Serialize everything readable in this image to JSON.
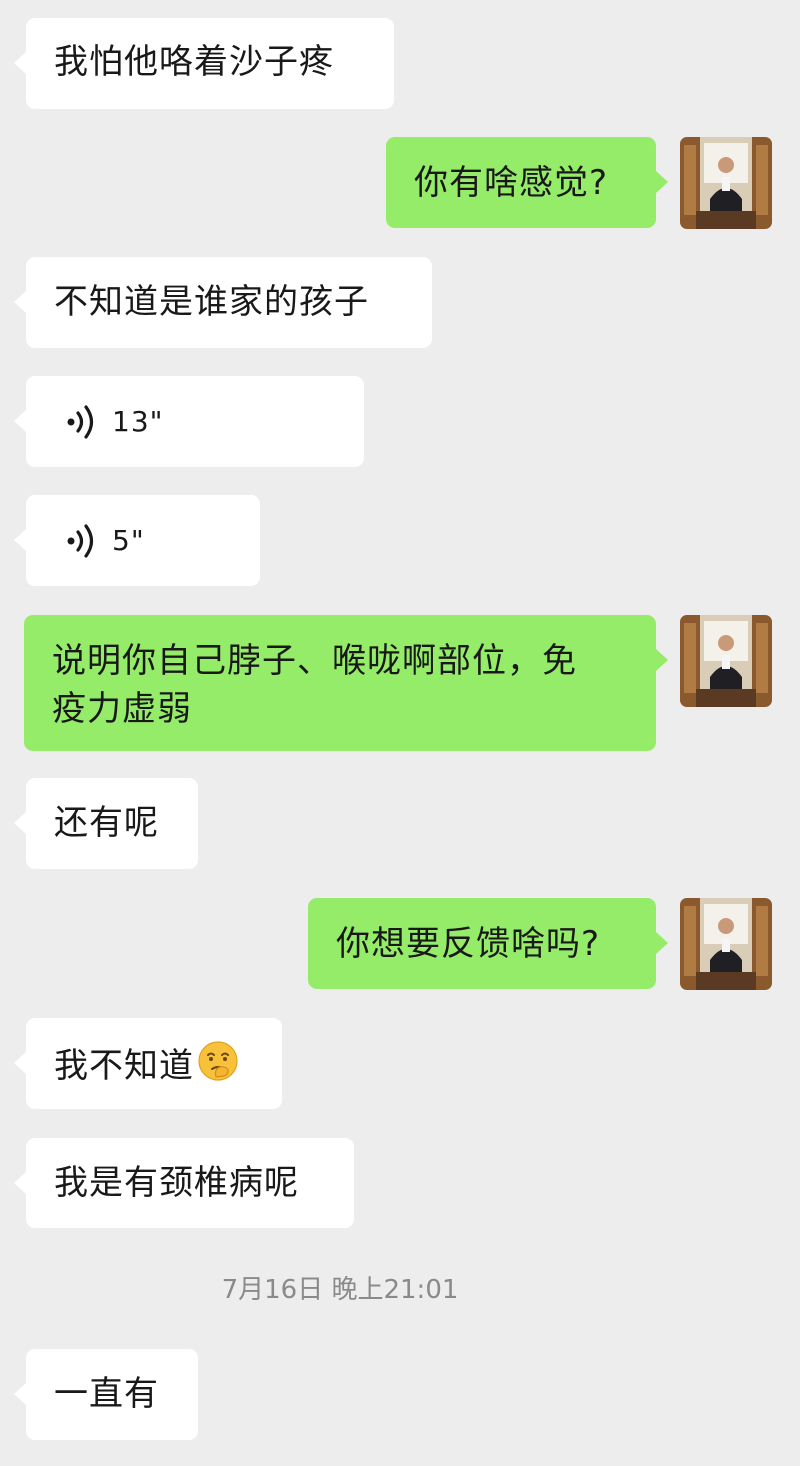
{
  "chat": {
    "messages": [
      {
        "side": "in",
        "type": "text",
        "text": "我怕他咯着沙子疼"
      },
      {
        "side": "out",
        "type": "text",
        "text": "你有啥感觉?"
      },
      {
        "side": "in",
        "type": "text",
        "text": "不知道是谁家的孩子"
      },
      {
        "side": "in",
        "type": "voice",
        "duration": "13\""
      },
      {
        "side": "in",
        "type": "voice",
        "duration": "5\""
      },
      {
        "side": "out",
        "type": "text",
        "line1": "说明你自己脖子、喉咙啊部位，免",
        "line2": "疫力虚弱"
      },
      {
        "side": "in",
        "type": "text",
        "text": "还有呢"
      },
      {
        "side": "out",
        "type": "text",
        "text": "你想要反馈啥吗?"
      },
      {
        "side": "in",
        "type": "text",
        "text": "我不知道",
        "emoji": "thinking-face-emoji"
      },
      {
        "side": "in",
        "type": "text",
        "text": "我是有颈椎病呢"
      },
      {
        "side": "in",
        "type": "text",
        "text": "一直有"
      }
    ],
    "timestamp": "7月16日 晚上21:01"
  },
  "colors": {
    "background": "#ededed",
    "incoming_bubble": "#ffffff",
    "outgoing_bubble": "#95ec69",
    "timestamp_text": "#8a8a8a"
  },
  "icons": {
    "voice": "voice-wave-icon",
    "avatar": "user-avatar"
  }
}
